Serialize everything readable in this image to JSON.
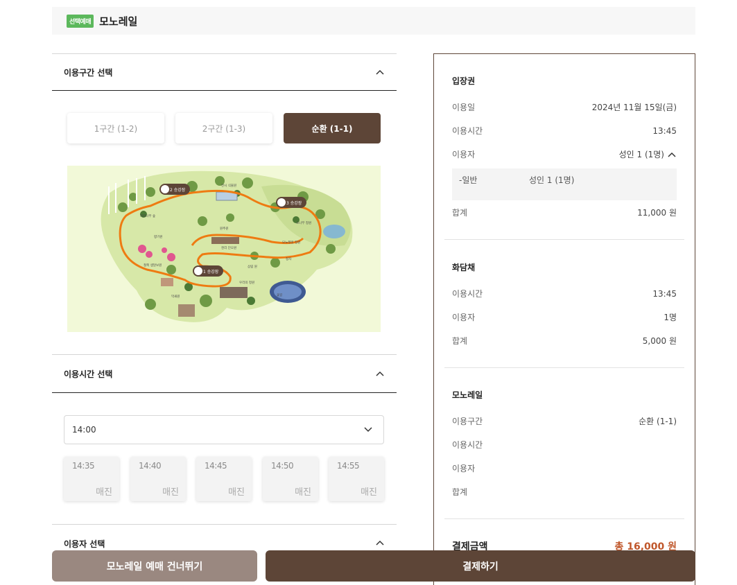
{
  "header": {
    "badge": "선택예매",
    "title": "모노레일"
  },
  "sections": {
    "route": {
      "title": "이용구간 선택"
    },
    "time": {
      "title": "이용시간 선택"
    },
    "users": {
      "title": "이용자 선택"
    }
  },
  "segments": [
    {
      "label": "1구간 (1-2)",
      "selected": false
    },
    {
      "label": "2구간 (1-3)",
      "selected": false
    },
    {
      "label": "순환 (1-1)",
      "selected": true
    }
  ],
  "map": {
    "stations": [
      "2 승강장",
      "3 승강장",
      "1 승강장"
    ],
    "labels": [
      "전시 식물원",
      "자작나무 숲",
      "원추원",
      "향기원",
      "철쭉 생달보원",
      "천리 단오원",
      "모노레일 정원",
      "우리의 정원",
      "억새원",
      "소나무 정원",
      "정자",
      "삼림 원",
      "꽃길"
    ]
  },
  "time_select": {
    "value": "14:00"
  },
  "time_slots": [
    {
      "time": "14:35",
      "status": "매진"
    },
    {
      "time": "14:40",
      "status": "매진"
    },
    {
      "time": "14:45",
      "status": "매진"
    },
    {
      "time": "14:50",
      "status": "매진"
    },
    {
      "time": "14:55",
      "status": "매진"
    }
  ],
  "summary": {
    "ticket": {
      "title": "입장권",
      "date_label": "이용일",
      "date_value": "2024년 11월 15일(금)",
      "time_label": "이용시간",
      "time_value": "13:45",
      "user_label": "이용자",
      "user_value": "성인 1 (1명)",
      "detail_type": "-일반",
      "detail_value": "성인 1 (1명)",
      "total_label": "합계",
      "total_value": "11,000 원"
    },
    "hwadamchae": {
      "title": "화담채",
      "time_label": "이용시간",
      "time_value": "13:45",
      "user_label": "이용자",
      "user_value": "1명",
      "total_label": "합계",
      "total_value": "5,000 원"
    },
    "monorail": {
      "title": "모노레일",
      "route_label": "이용구간",
      "route_value": "순환 (1-1)",
      "time_label": "이용시간",
      "user_label": "이용자",
      "total_label": "합계"
    },
    "payment": {
      "label": "결제금액",
      "value": "총 16,000 원"
    }
  },
  "buttons": {
    "skip": "모노레일 예매 건너뛰기",
    "pay": "결제하기"
  },
  "colors": {
    "primary": "#5d4537",
    "secondary": "#9a8880",
    "badge": "#5cb85c",
    "accent": "#c0572b"
  }
}
